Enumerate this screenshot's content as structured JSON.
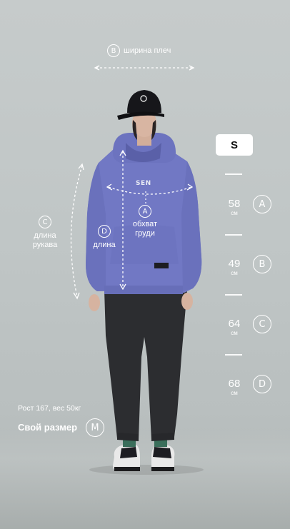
{
  "labels": {
    "shoulder_width": {
      "letter": "B",
      "text": "ширина плеч"
    },
    "sleeve_length": {
      "letter": "C",
      "line1": "длина",
      "line2": "рукава"
    },
    "chest_girth": {
      "letter": "A",
      "line1": "обхват",
      "line2": "груди"
    },
    "body_length": {
      "letter": "D",
      "text": "длина"
    }
  },
  "hoodie_print": "SEN",
  "size_selector": {
    "selected": "S"
  },
  "measurements": [
    {
      "value": "58",
      "unit": "см",
      "letter": "A"
    },
    {
      "value": "49",
      "unit": "см",
      "letter": "B"
    },
    {
      "value": "64",
      "unit": "см",
      "letter": "C"
    },
    {
      "value": "68",
      "unit": "см",
      "letter": "D"
    }
  ],
  "model_info": "Рост 167, вес 50кг",
  "own_size": {
    "label": "Свой размер",
    "letter": "M"
  },
  "colors": {
    "hoodie": "#7178c4",
    "pants": "#2c2d30",
    "background": "#c2c7c7",
    "accent": "#ffffff"
  }
}
